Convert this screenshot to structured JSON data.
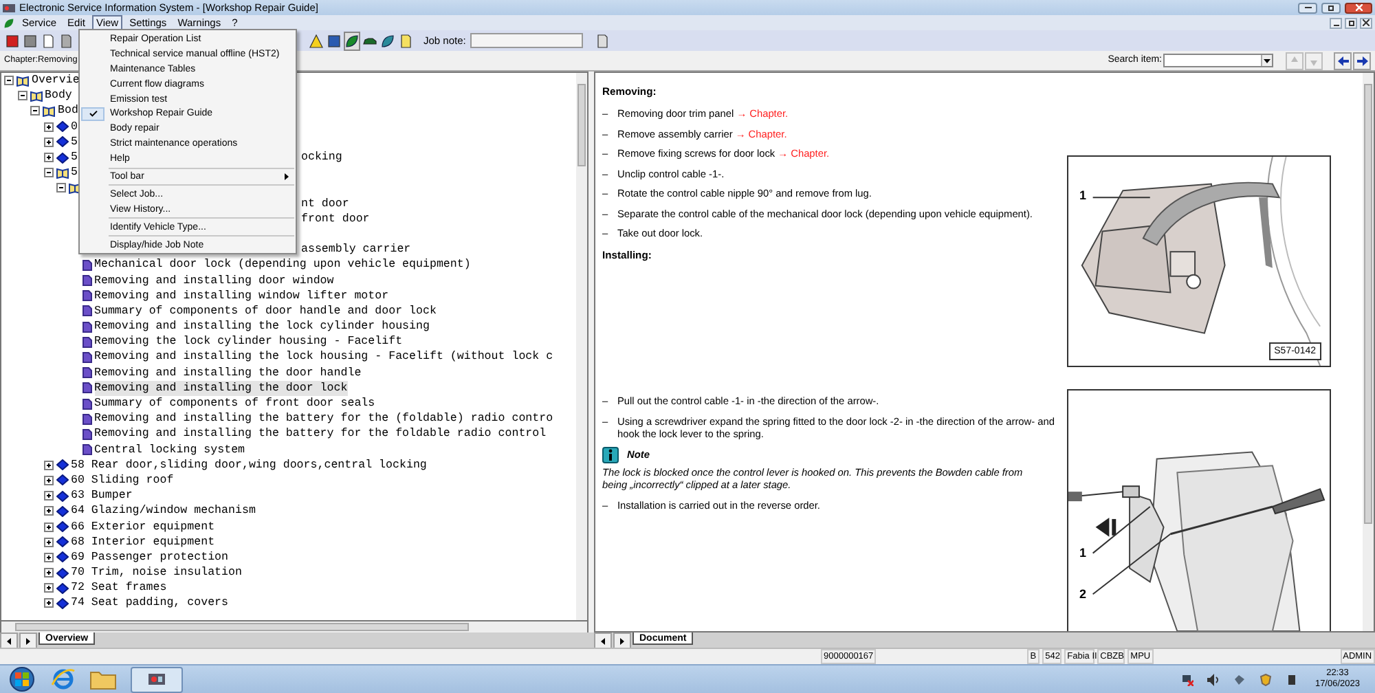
{
  "window": {
    "title": "Electronic Service Information System - [Workshop Repair Guide]"
  },
  "menu_bar": [
    {
      "label": "Service",
      "open": false
    },
    {
      "label": "Edit",
      "open": false
    },
    {
      "label": "View",
      "open": true
    },
    {
      "label": "Settings",
      "open": false
    },
    {
      "label": "Warnings",
      "open": false
    },
    {
      "label": "?",
      "open": false
    }
  ],
  "view_menu": [
    {
      "kind": "item",
      "label": "Repair Operation List",
      "checked": false
    },
    {
      "kind": "item",
      "label": "Technical service manual offline (HST2)",
      "checked": false
    },
    {
      "kind": "item",
      "label": "Maintenance Tables",
      "checked": false
    },
    {
      "kind": "item",
      "label": "Current flow diagrams",
      "checked": false
    },
    {
      "kind": "item",
      "label": "Emission test",
      "checked": false
    },
    {
      "kind": "item",
      "label": "Workshop Repair Guide",
      "checked": true
    },
    {
      "kind": "item",
      "label": "Body repair",
      "checked": false
    },
    {
      "kind": "item",
      "label": "Strict maintenance operations",
      "checked": false
    },
    {
      "kind": "item",
      "label": "Help",
      "checked": false
    },
    {
      "kind": "separator"
    },
    {
      "kind": "submenu",
      "label": "Tool bar",
      "checked": false
    },
    {
      "kind": "separator"
    },
    {
      "kind": "item",
      "label": "Select Job...",
      "checked": false
    },
    {
      "kind": "item",
      "label": "View History...",
      "checked": false
    },
    {
      "kind": "separator"
    },
    {
      "kind": "item",
      "label": "Identify Vehicle Type...",
      "checked": false
    },
    {
      "kind": "separator"
    },
    {
      "kind": "item",
      "label": "Display/hide Job Note",
      "checked": false
    }
  ],
  "toolbar": {
    "job_note_label": "Job note:"
  },
  "chapter_bar": {
    "label": "Chapter:Removing"
  },
  "search": {
    "label": "Search item:"
  },
  "tree": [
    {
      "kind": "book",
      "label": "Overvie",
      "expanded": true,
      "selected": false,
      "children": [
        {
          "kind": "book",
          "label": "Body",
          "expanded": true,
          "selected": false,
          "children": [
            {
              "kind": "book",
              "label": "Bod",
              "expanded": true,
              "selected": false,
              "children": [
                {
                  "kind": "chapter",
                  "label": "0",
                  "expanded": false,
                  "selected": false
                },
                {
                  "kind": "chapter",
                  "label": "5",
                  "expanded": false,
                  "selected": false
                },
                {
                  "kind": "chapter",
                  "label": "5",
                  "right": "ocking",
                  "expanded": false,
                  "selected": false
                },
                {
                  "kind": "book",
                  "label": "5",
                  "expanded": true,
                  "selected": false,
                  "children": [
                    {
                      "kind": "book",
                      "expanded": true,
                      "children": [
                        {
                          "kind": "page",
                          "right": "nt door",
                          "selected": false
                        },
                        {
                          "kind": "page",
                          "right": "front door",
                          "selected": false
                        },
                        {
                          "kind": "covered"
                        },
                        {
                          "kind": "page",
                          "right": "assembly carrier",
                          "selected": false
                        },
                        {
                          "kind": "page",
                          "label": "Mechanical door lock (depending upon vehicle equipment)",
                          "selected": false
                        },
                        {
                          "kind": "page",
                          "label": "Removing and installing door window",
                          "selected": false
                        },
                        {
                          "kind": "page",
                          "label": "Removing and installing window lifter motor",
                          "selected": false
                        },
                        {
                          "kind": "page",
                          "label": "Summary of components of door handle and door lock",
                          "selected": false
                        },
                        {
                          "kind": "page",
                          "label": "Removing and installing the lock cylinder housing",
                          "selected": false
                        },
                        {
                          "kind": "page",
                          "label": "Removing the lock cylinder housing - Facelift",
                          "selected": false
                        },
                        {
                          "kind": "page",
                          "label": "Removing and installing the lock housing - Facelift (without lock c",
                          "selected": false
                        },
                        {
                          "kind": "page",
                          "label": "Removing and installing the door handle",
                          "selected": false
                        },
                        {
                          "kind": "page",
                          "label": "Removing and installing the door lock",
                          "selected": true
                        },
                        {
                          "kind": "page",
                          "label": "Summary of components of front door seals",
                          "selected": false
                        },
                        {
                          "kind": "page",
                          "label": "Removing and installing the battery for the (foldable) radio contro",
                          "selected": false
                        },
                        {
                          "kind": "page",
                          "label": "Removing and installing the battery for the foldable radio control",
                          "selected": false
                        },
                        {
                          "kind": "page",
                          "label": "Central locking system",
                          "selected": false
                        }
                      ]
                    }
                  ]
                },
                {
                  "kind": "chapter",
                  "label": "58 Rear door,sliding door,wing doors,central locking",
                  "expanded": false,
                  "selected": false
                },
                {
                  "kind": "chapter",
                  "label": "60 Sliding roof",
                  "expanded": false,
                  "selected": false
                },
                {
                  "kind": "chapter",
                  "label": "63 Bumper",
                  "expanded": false,
                  "selected": false
                },
                {
                  "kind": "chapter",
                  "label": "64 Glazing/window mechanism",
                  "expanded": false,
                  "selected": false
                },
                {
                  "kind": "chapter",
                  "label": "66 Exterior equipment",
                  "expanded": false,
                  "selected": false
                },
                {
                  "kind": "chapter",
                  "label": "68 Interior equipment",
                  "expanded": false,
                  "selected": false
                },
                {
                  "kind": "chapter",
                  "label": "69 Passenger protection",
                  "expanded": false,
                  "selected": false
                },
                {
                  "kind": "chapter",
                  "label": "70 Trim, noise insulation",
                  "expanded": false,
                  "selected": false
                },
                {
                  "kind": "chapter",
                  "label": "72 Seat frames",
                  "expanded": false,
                  "selected": false
                },
                {
                  "kind": "chapter",
                  "label": "74 Seat padding, covers",
                  "expanded": false,
                  "selected": false
                }
              ]
            }
          ]
        }
      ]
    }
  ],
  "document": {
    "sections": [
      {
        "blocks": [
          {
            "kind": "heading",
            "text": "Removing:"
          },
          {
            "kind": "step",
            "bullet": "–",
            "text": "Removing door trim panel",
            "link": "→ Chapter."
          },
          {
            "kind": "step",
            "bullet": "–",
            "text": "Remove assembly carrier",
            "link": "→ Chapter."
          },
          {
            "kind": "step",
            "bullet": "–",
            "text": "Remove fixing screws for door lock",
            "link": "→ Chapter."
          },
          {
            "kind": "step",
            "bullet": "–",
            "text": "Unclip control cable -1-."
          },
          {
            "kind": "step",
            "bullet": "–",
            "text": "Rotate the control cable nipple 90° and remove from lug."
          },
          {
            "kind": "step",
            "bullet": "–",
            "text": "Separate the control cable of the mechanical door lock (depending upon vehicle equipment)."
          },
          {
            "kind": "step",
            "bullet": "–",
            "text": "Take out door lock."
          },
          {
            "kind": "heading",
            "text": "Installing:"
          }
        ],
        "figure": {
          "callouts": [
            "1"
          ],
          "tag": "S57-0142"
        }
      },
      {
        "blocks": [
          {
            "kind": "step",
            "bullet": "–",
            "text": "Pull out the control cable -1- in -the direction of the arrow-."
          },
          {
            "kind": "step",
            "bullet": "–",
            "text": "Using a screwdriver expand the spring fitted to the door lock -2- in -the direction of the arrow- and hook the lock lever to the spring."
          },
          {
            "kind": "note_title",
            "text": "Note"
          },
          {
            "kind": "note_text",
            "text": "The lock is blocked once the control lever is hooked on. This prevents the Bowden cable from being „incorrectly“ clipped at a later stage."
          },
          {
            "kind": "step",
            "bullet": "–",
            "text": "Installation is carried out in the reverse order."
          }
        ],
        "figure": {
          "callouts": [
            "1",
            "2"
          ]
        }
      }
    ]
  },
  "left_tabs": [
    {
      "label": "Overview",
      "selected": true
    }
  ],
  "right_tabs": [
    {
      "label": "Document",
      "selected": true
    }
  ],
  "status_bar": [
    "9000000167",
    "B",
    "542",
    "Fabia II",
    "CBZB",
    "MPU",
    "ADMIN"
  ],
  "taskbar": {
    "time": "22:33",
    "date": "17/06/2023"
  }
}
